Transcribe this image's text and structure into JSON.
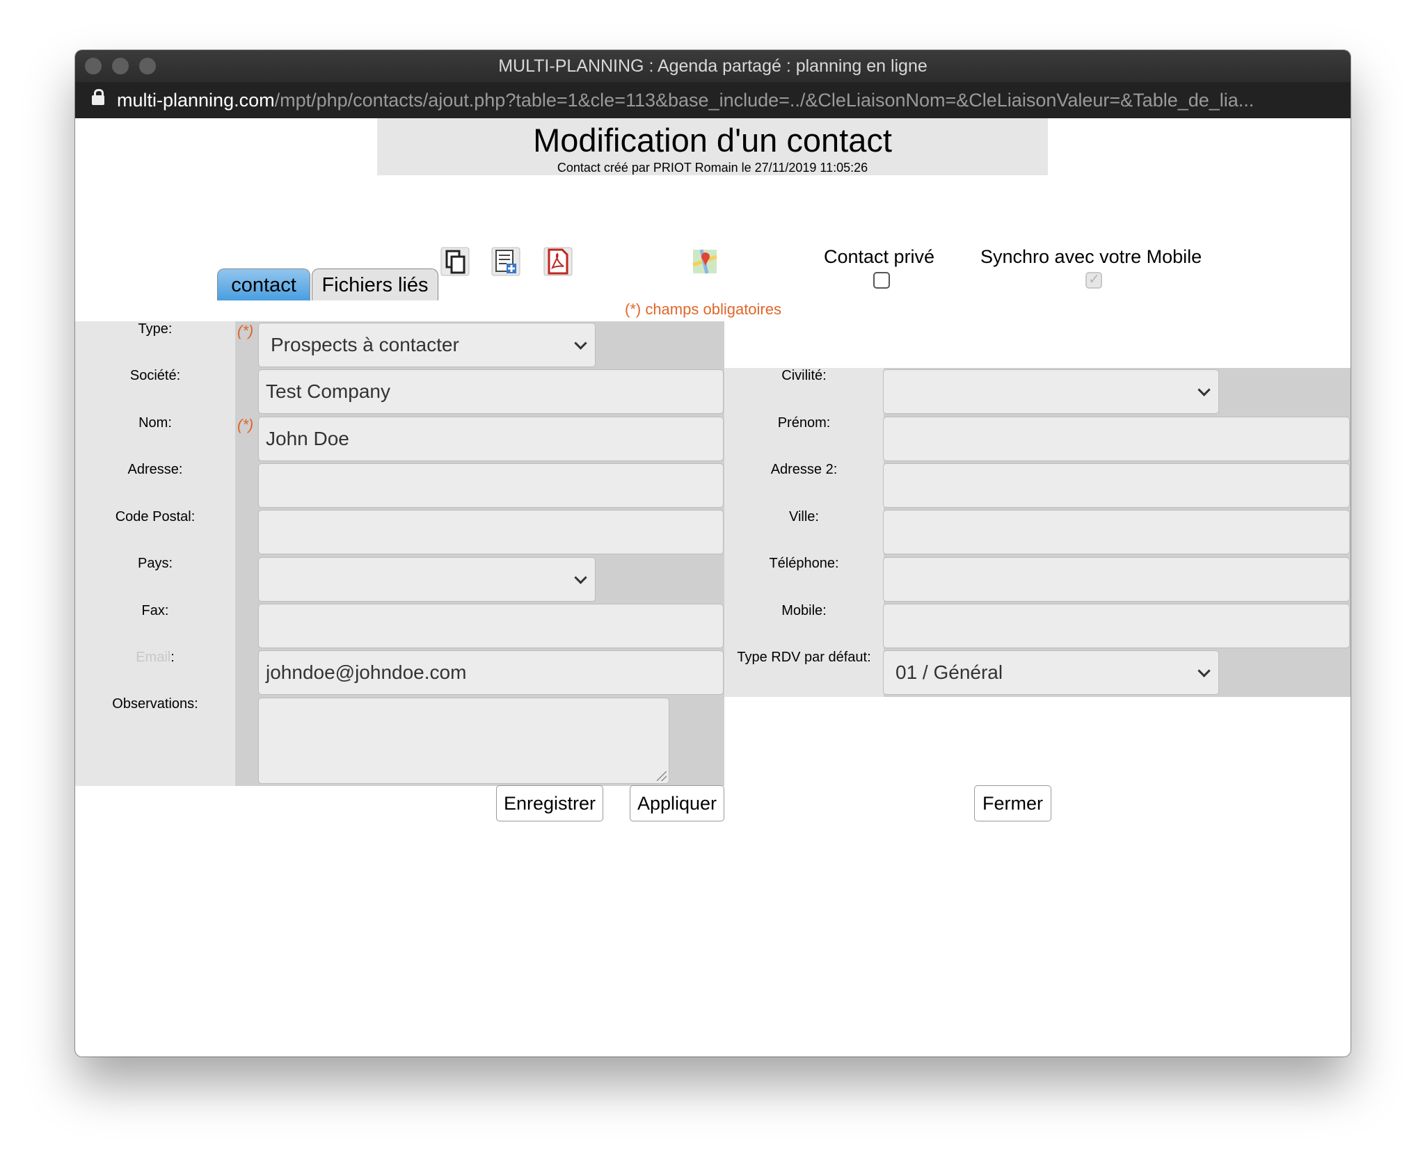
{
  "window": {
    "title": "MULTI-PLANNING : Agenda partagé : planning en ligne",
    "url_domain": "multi-planning.com",
    "url_path": "/mpt/php/contacts/ajout.php?table=1&cle=113&base_include=../&CleLiaisonNom=&CleLiaisonValeur=&Table_de_lia..."
  },
  "header": {
    "title": "Modification d'un contact",
    "subtitle": "Contact créé par PRIOT Romain le 27/11/2019 11:05:26"
  },
  "tabs": [
    {
      "label": "contact",
      "active": true
    },
    {
      "label": "Fichiers liés",
      "active": false
    }
  ],
  "toolbar": {
    "icons": [
      "copy-icon",
      "add-note-icon",
      "pdf-icon",
      "map-icon"
    ]
  },
  "options": {
    "private_label": "Contact privé",
    "private_checked": false,
    "sync_label": "Synchro avec votre Mobile",
    "sync_checked": true
  },
  "required_note": "(*) champs obligatoires",
  "required_marker": "(*)",
  "form": {
    "left": {
      "type": {
        "label": "Type:",
        "value": "Prospects à contacter"
      },
      "societe": {
        "label": "Société:",
        "value": "Test Company"
      },
      "nom": {
        "label": "Nom:",
        "value": "John Doe"
      },
      "adresse": {
        "label": "Adresse:",
        "value": ""
      },
      "code_postal": {
        "label": "Code Postal:",
        "value": ""
      },
      "pays": {
        "label": "Pays:",
        "value": ""
      },
      "fax": {
        "label": "Fax:",
        "value": ""
      },
      "email": {
        "label_link": "Email",
        "label_suffix": ":",
        "value": "johndoe@johndoe.com"
      },
      "observations": {
        "label": "Observations:",
        "value": ""
      }
    },
    "right": {
      "civilite": {
        "label": "Civilité:",
        "value": ""
      },
      "prenom": {
        "label": "Prénom:",
        "value": ""
      },
      "adresse2": {
        "label": "Adresse 2:",
        "value": ""
      },
      "ville": {
        "label": "Ville:",
        "value": ""
      },
      "telephone": {
        "label": "Téléphone:",
        "value": ""
      },
      "mobile": {
        "label": "Mobile:",
        "value": ""
      },
      "type_rdv": {
        "label": "Type RDV par défaut:",
        "value": "01 / Général"
      }
    }
  },
  "buttons": {
    "save": "Enregistrer",
    "apply": "Appliquer",
    "close": "Fermer"
  },
  "colors": {
    "accent_tab": "#4a9ee0",
    "required": "#e0662a",
    "email_link": "#c8c8c8"
  }
}
